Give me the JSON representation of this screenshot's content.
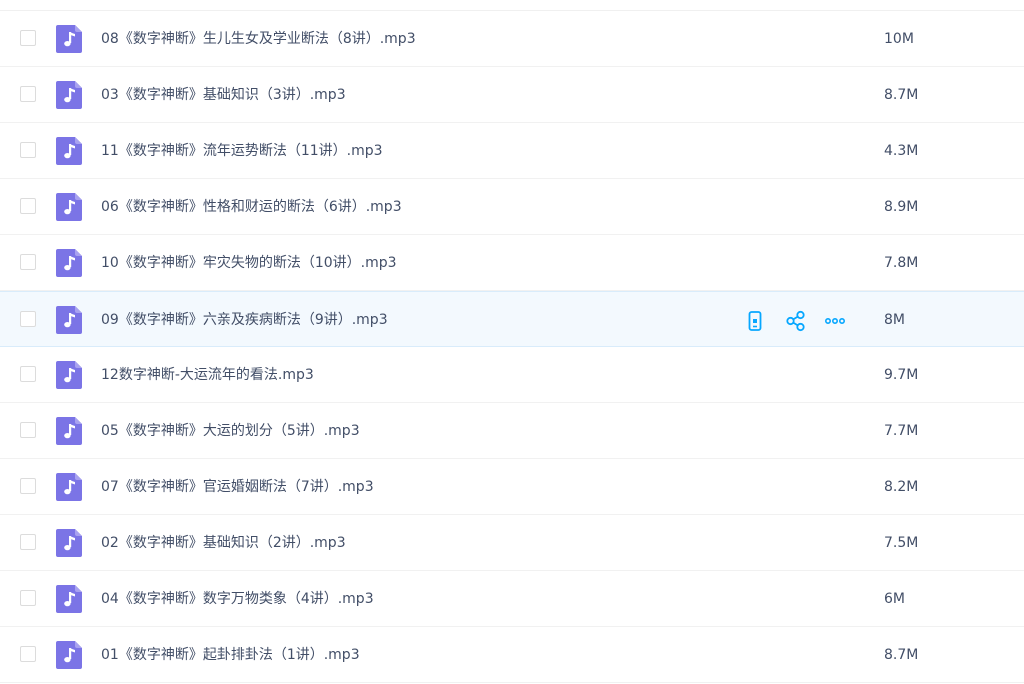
{
  "file_list": {
    "rows": [
      {
        "name": "08《数字神断》生儿生女及学业断法（8讲）.mp3",
        "size": "10M",
        "icon": "audio-file-icon"
      },
      {
        "name": "03《数字神断》基础知识（3讲）.mp3",
        "size": "8.7M",
        "icon": "audio-file-icon"
      },
      {
        "name": "11《数字神断》流年运势断法（11讲）.mp3",
        "size": "4.3M",
        "icon": "audio-file-icon"
      },
      {
        "name": "06《数字神断》性格和财运的断法（6讲）.mp3",
        "size": "8.9M",
        "icon": "audio-file-icon"
      },
      {
        "name": "10《数字神断》牢灾失物的断法（10讲）.mp3",
        "size": "7.8M",
        "icon": "audio-file-icon"
      },
      {
        "name": "09《数字神断》六亲及疾病断法（9讲）.mp3",
        "size": "8M",
        "icon": "audio-file-icon",
        "hovered": true
      },
      {
        "name": "12数字神断-大运流年的看法.mp3",
        "size": "9.7M",
        "icon": "audio-file-icon"
      },
      {
        "name": "05《数字神断》大运的划分（5讲）.mp3",
        "size": "7.7M",
        "icon": "audio-file-icon"
      },
      {
        "name": "07《数字神断》官运婚姻断法（7讲）.mp3",
        "size": "8.2M",
        "icon": "audio-file-icon"
      },
      {
        "name": "02《数字神断》基础知识（2讲）.mp3",
        "size": "7.5M",
        "icon": "audio-file-icon"
      },
      {
        "name": "04《数字神断》数字万物类象（4讲）.mp3",
        "size": "6M",
        "icon": "audio-file-icon"
      },
      {
        "name": "01《数字神断》起卦排卦法（1讲）.mp3",
        "size": "8.7M",
        "icon": "audio-file-icon"
      }
    ],
    "hover_actions": [
      "send-to-phone-icon",
      "share-icon",
      "more-icon"
    ]
  },
  "colors": {
    "text": "#424e67",
    "icon_purple": "#7b74e6",
    "action_blue": "#06a7ff",
    "hover_bg": "#f3f9fe",
    "divider": "#f1f1f1"
  }
}
